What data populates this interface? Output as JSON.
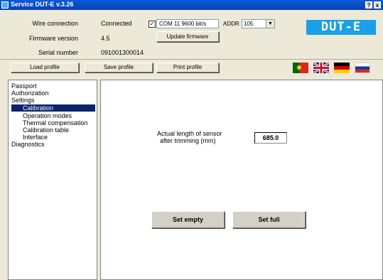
{
  "window": {
    "title": "Service DUT-E  v.3.26",
    "help_btn": "?",
    "close_btn": "x"
  },
  "info": {
    "wire_connection_label": "Wire connection",
    "wire_connection_value": "Connected",
    "firmware_label": "Firmware version",
    "firmware_value": "4.5",
    "serial_label": "Serial number",
    "serial_value": "091001300014"
  },
  "connection": {
    "checkbox_checked": true,
    "checkbox_mark": "✓",
    "port_value": "COM 11   9600 bit/s",
    "addr_label": "ADDR",
    "addr_value": "105",
    "update_firmware_label": "Update firmware"
  },
  "logo": {
    "text": "DUT-E"
  },
  "toolbar": {
    "load_label": "Load profile",
    "save_label": "Save profile",
    "print_label": "Print profile"
  },
  "languages": [
    {
      "name": "portugal-flag",
      "color": "#d52b1e"
    },
    {
      "name": "uk-flag",
      "color": "#012169"
    },
    {
      "name": "germany-flag",
      "color": "#000000"
    },
    {
      "name": "russia-flag",
      "color": "#0039a6"
    }
  ],
  "nav": {
    "items": [
      {
        "label": "Passport"
      },
      {
        "label": "Authorization"
      },
      {
        "label": "Settings"
      },
      {
        "label": "Calibration",
        "selected": true
      },
      {
        "label": "Operation modes"
      },
      {
        "label": "Thermal compensation"
      },
      {
        "label": "Calibration table"
      },
      {
        "label": "Interface"
      },
      {
        "label": "Diagnostics"
      }
    ]
  },
  "main": {
    "length_label_line1": "Actual length of sensor",
    "length_label_line2": "after trimming (mm)",
    "length_value": "685.0",
    "set_empty_label": "Set empty",
    "set_full_label": "Set full"
  }
}
